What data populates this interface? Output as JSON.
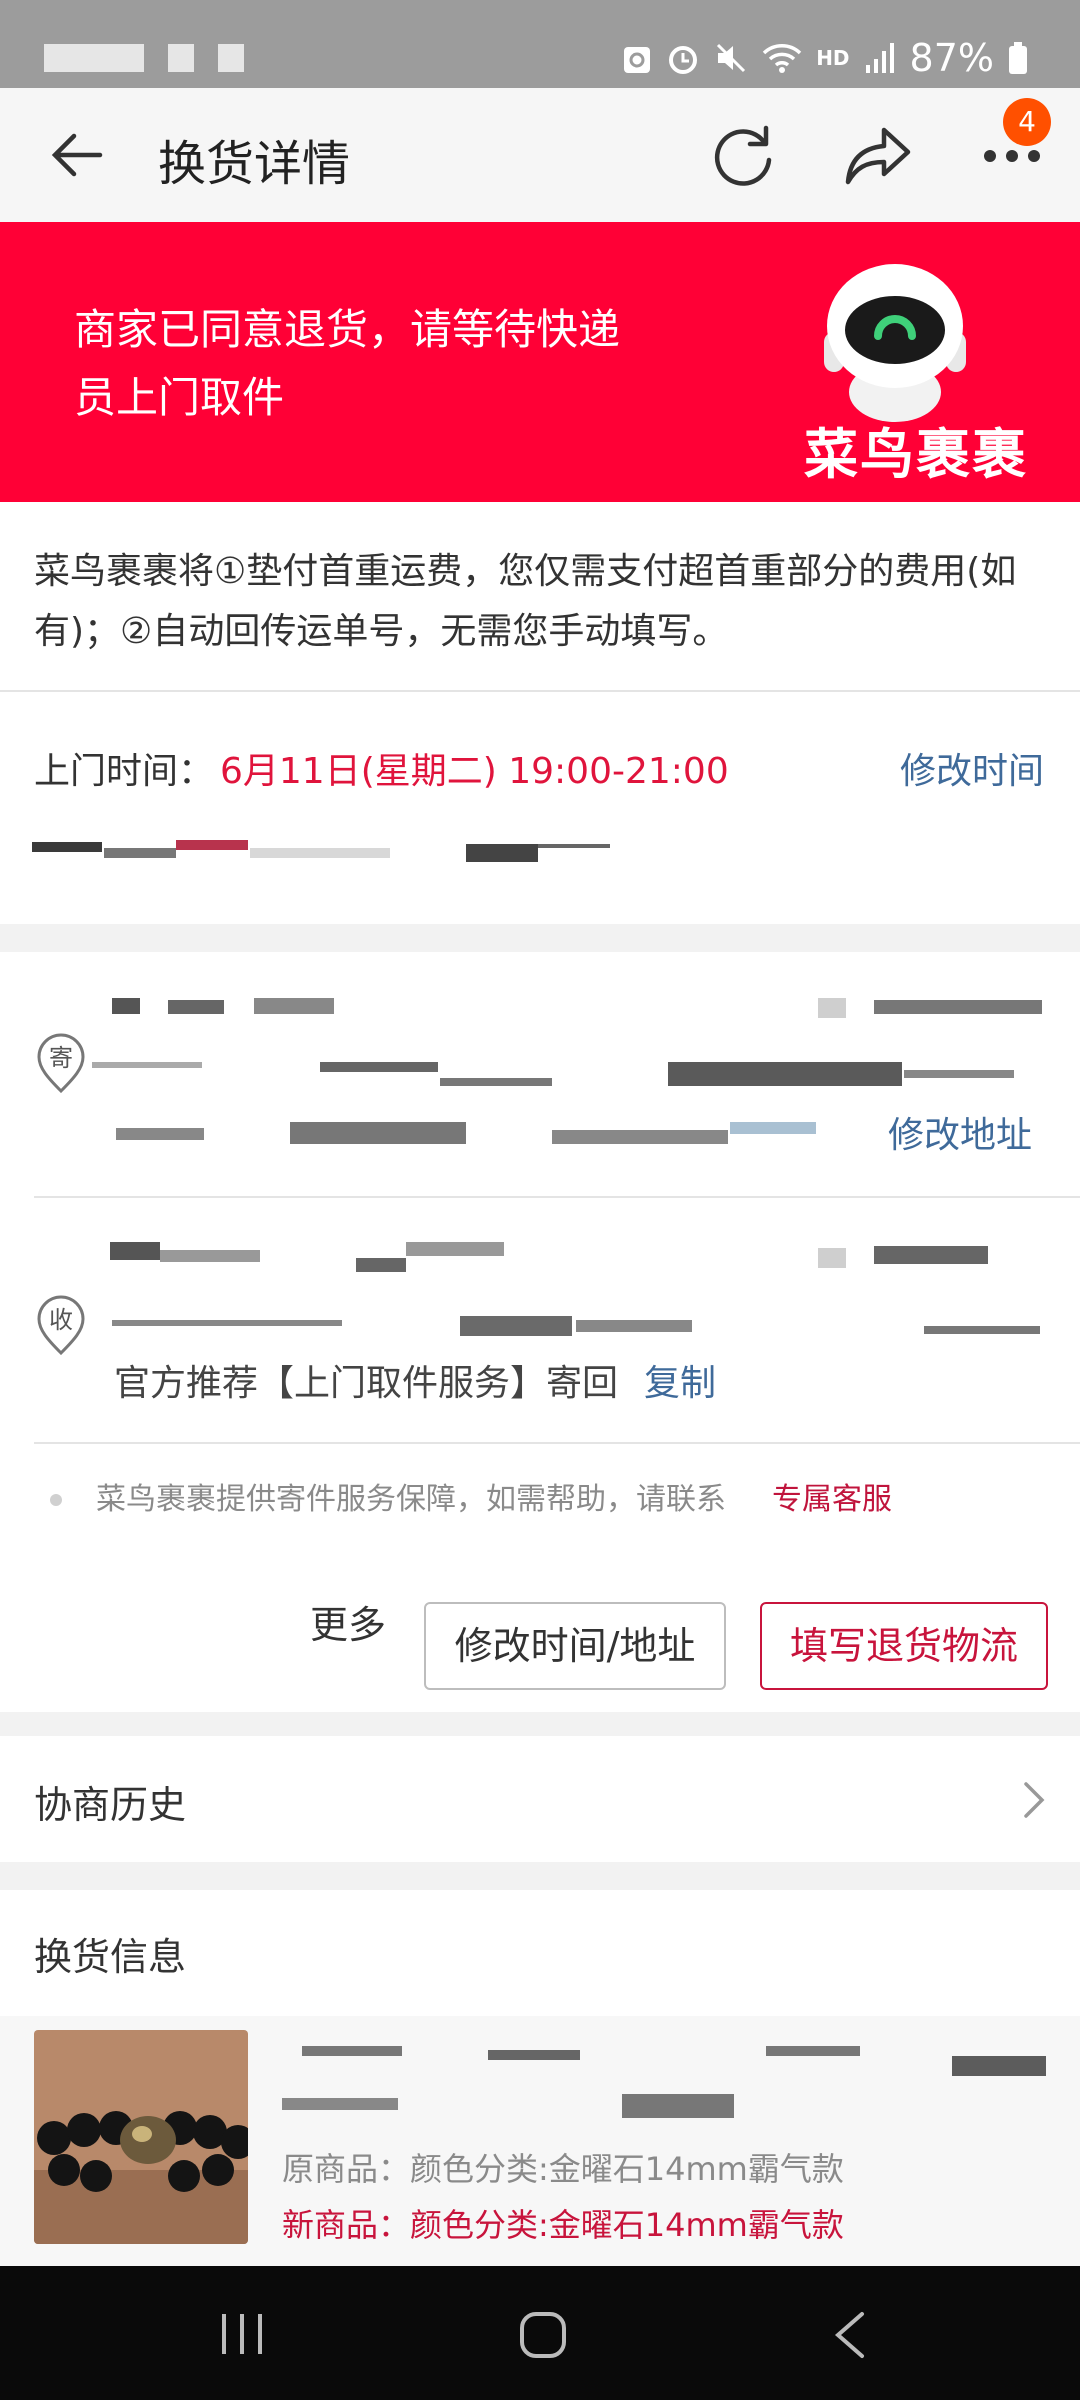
{
  "status_bar": {
    "battery_percent": "87%",
    "hd_label": "HD"
  },
  "header": {
    "title": "换货详情",
    "notification_count": "4"
  },
  "banner": {
    "message": "商家已同意退货，请等待快递员上门取件",
    "logo_text": "菜鸟裹裹",
    "background_color": "#ff0036"
  },
  "notice": {
    "text": "菜鸟裹裹将①垫付首重运费，您仅需支付超首重部分的费用(如有)；②自动回传运单号，无需您手动填写。"
  },
  "pickup": {
    "label": "上门时间：",
    "time": "6月11日(星期二) 19:00-21:00",
    "change_link": "修改时间"
  },
  "address": {
    "sender_icon_label": "寄",
    "receiver_icon_label": "收",
    "change_address_link": "修改地址",
    "recommend_text": "官方推荐【上门取件服务】寄回",
    "copy_link": "复制",
    "help_text": "菜鸟裹裹提供寄件服务保障，如需帮助，请联系",
    "help_link": "专属客服"
  },
  "actions": {
    "more_label": "更多",
    "modify_button": "修改时间/地址",
    "fill_logistics_button": "填写退货物流"
  },
  "history": {
    "title": "协商历史"
  },
  "exchange": {
    "title": "换货信息",
    "original_goods": "原商品：颜色分类:金曜石14mm霸气款",
    "new_goods": "新商品：颜色分类:金曜石14mm霸气款"
  },
  "colors": {
    "accent_red": "#e0143c",
    "link_blue": "#3f6a9a"
  }
}
